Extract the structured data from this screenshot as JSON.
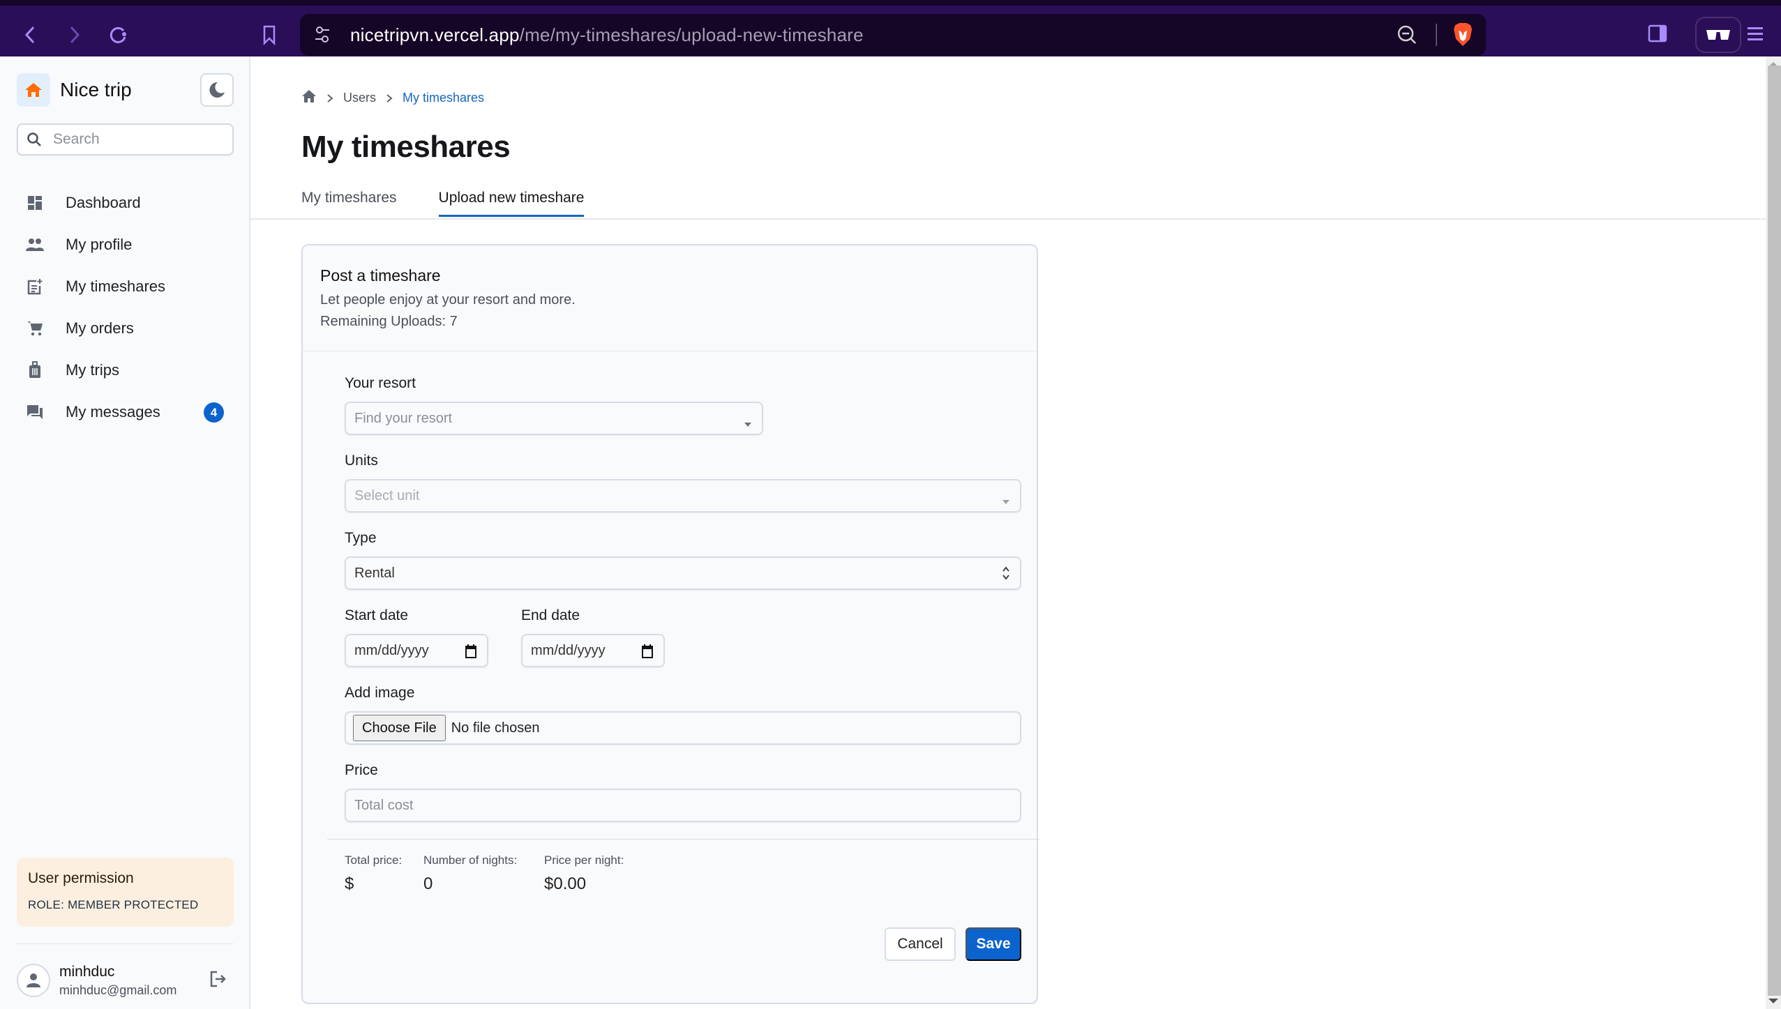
{
  "browser": {
    "url_host": "nicetripvn.vercel.app",
    "url_path": "/me/my-timeshares/upload-new-timeshare",
    "icons": [
      "back-icon",
      "forward-icon",
      "reload-icon",
      "bookmark-icon",
      "site-settings-icon",
      "zoom-out-icon",
      "brave-shield-icon",
      "sidebar-icon",
      "reader-mode-icon",
      "menu-icon"
    ]
  },
  "sidebar": {
    "brand": "Nice trip",
    "search_placeholder": "Search",
    "items": [
      {
        "label": "Dashboard",
        "icon": "dashboard-icon"
      },
      {
        "label": "My profile",
        "icon": "people-icon"
      },
      {
        "label": "My timeshares",
        "icon": "post-add-icon"
      },
      {
        "label": "My orders",
        "icon": "cart-icon"
      },
      {
        "label": "My trips",
        "icon": "luggage-icon"
      },
      {
        "label": "My messages",
        "icon": "forum-icon",
        "badge": "4"
      }
    ],
    "permission": {
      "title": "User permission",
      "role": "ROLE: MEMBER PROTECTED"
    },
    "user": {
      "name": "minhduc",
      "email": "minhduc@gmail.com"
    }
  },
  "main": {
    "breadcrumb": [
      "Users",
      "My timeshares"
    ],
    "title": "My timeshares",
    "tabs": [
      {
        "label": "My timeshares",
        "active": false
      },
      {
        "label": "Upload new timeshare",
        "active": true
      }
    ],
    "card": {
      "title": "Post a timeshare",
      "subtitle": "Let people enjoy at your resort and more.",
      "remaining": "Remaining Uploads: 7",
      "fields": {
        "resort": {
          "label": "Your resort",
          "placeholder": "Find your resort"
        },
        "units": {
          "label": "Units",
          "placeholder": "Select unit"
        },
        "type": {
          "label": "Type",
          "value": "Rental"
        },
        "start_date": {
          "label": "Start date",
          "placeholder": "mm/dd/yyyy"
        },
        "end_date": {
          "label": "End date",
          "placeholder": "mm/dd/yyyy"
        },
        "image": {
          "label": "Add image",
          "button": "Choose File",
          "status": "No file chosen"
        },
        "price": {
          "label": "Price",
          "placeholder": "Total cost"
        }
      },
      "summary": {
        "total_price_label": "Total price:",
        "total_price_value": "$",
        "nights_label": "Number of nights:",
        "nights_value": "0",
        "per_night_label": "Price per night:",
        "per_night_value": "$0.00"
      },
      "cancel_label": "Cancel",
      "save_label": "Save"
    }
  },
  "colors": {
    "primary": "#0b63ce",
    "brand_orange": "#ff6d00",
    "browser_bar": "#2a0f58",
    "permission_bg": "#fdefe0"
  }
}
